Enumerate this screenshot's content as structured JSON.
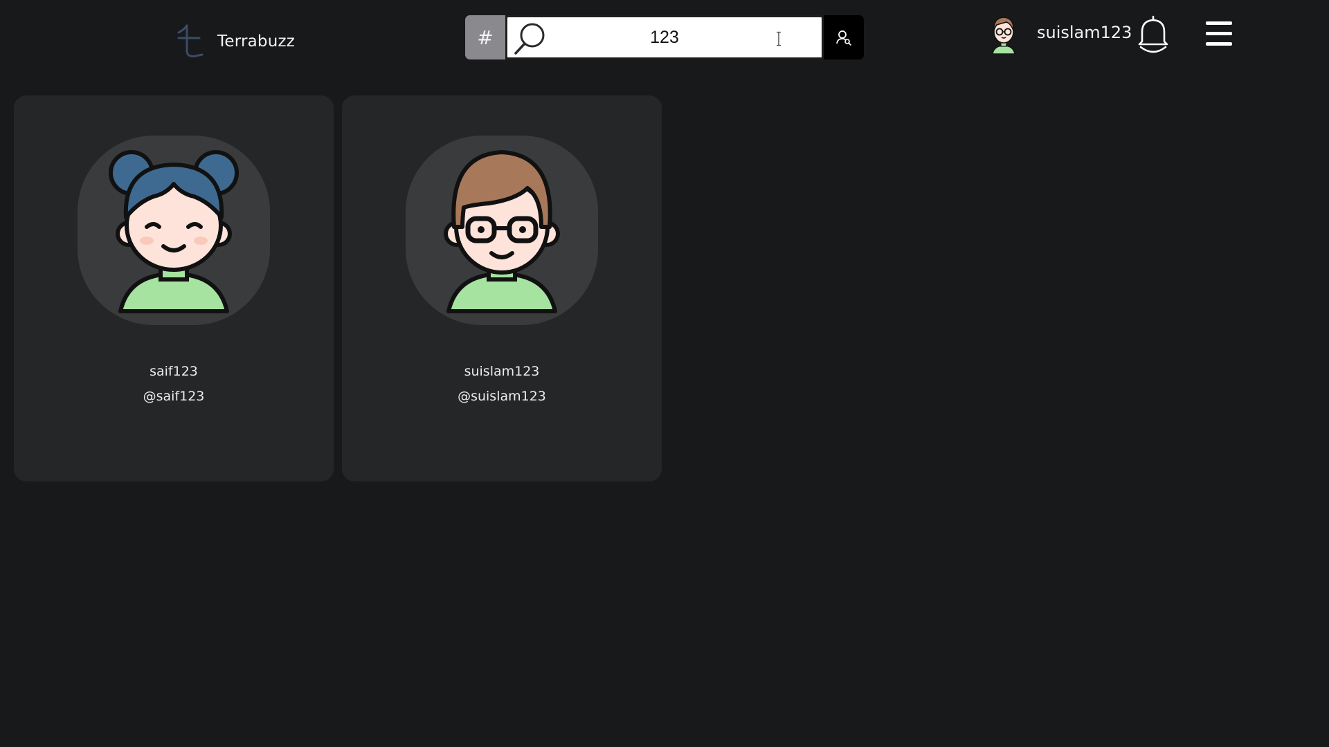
{
  "header": {
    "brand_name": "Terrabuzz",
    "search": {
      "hashtag_toggle": "#",
      "value": "123",
      "placeholder": ""
    },
    "current_user": {
      "username": "suislam123"
    }
  },
  "results": [
    {
      "display_name": "saif123",
      "handle": "@saif123"
    },
    {
      "display_name": "suislam123",
      "handle": "@suislam123"
    }
  ],
  "colors": {
    "background": "#18191b",
    "card": "#252628",
    "avatar_bg": "#3a3b3d",
    "hash_toggle": "#8a8a8e",
    "user_search_button": "#000000",
    "hair_blue": "#3e6a92",
    "hair_brown": "#a8785a",
    "shirt_green": "#a6e2a0",
    "skin": "#fde3da"
  },
  "icons": [
    "terrabuzz-logo-icon",
    "search-icon",
    "user-search-icon",
    "bell-icon",
    "hamburger-menu-icon"
  ]
}
